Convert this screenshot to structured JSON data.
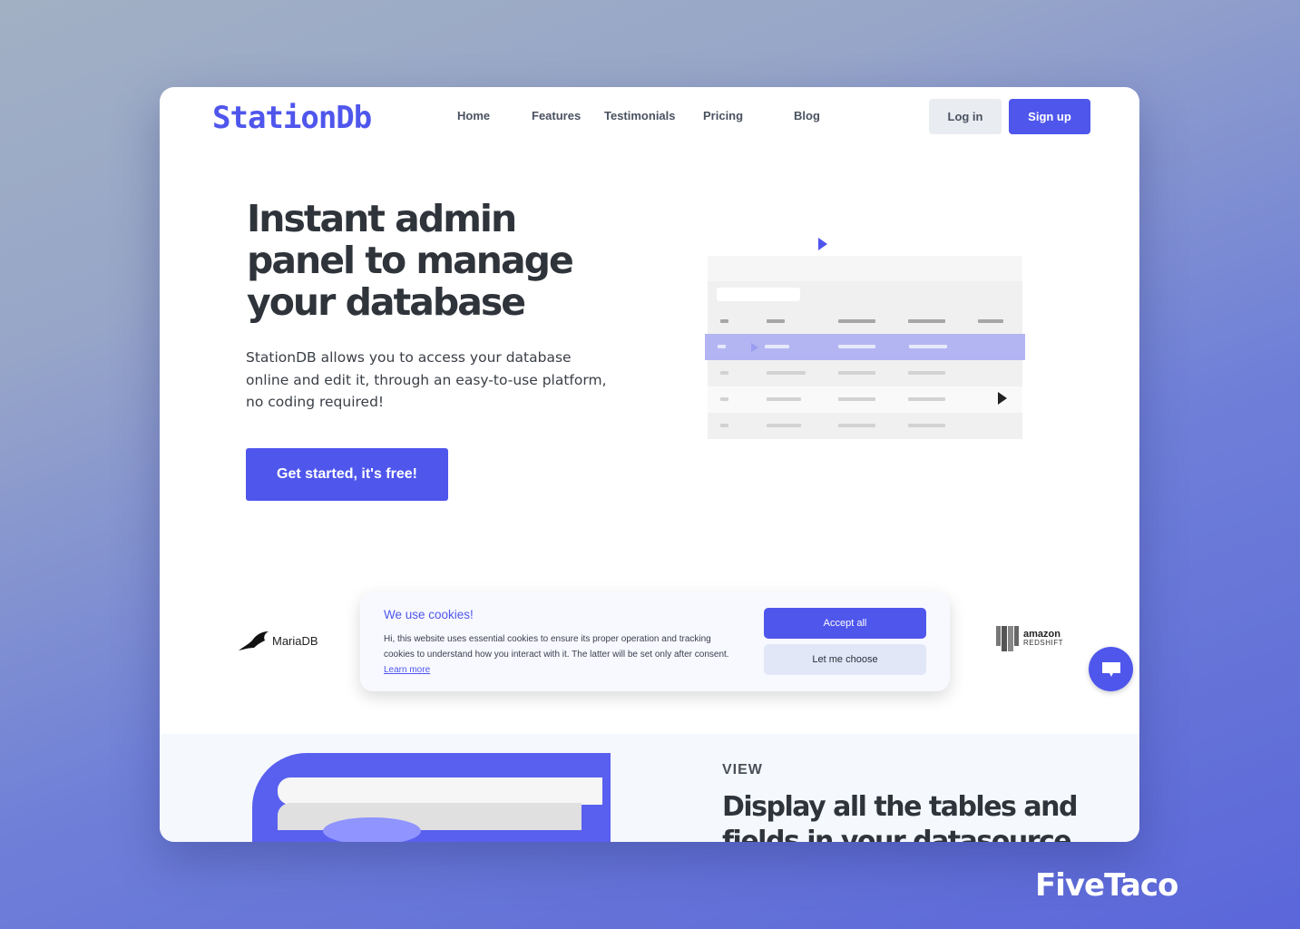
{
  "brand": {
    "logo": "StationDb",
    "accent": "#4f56ec",
    "watermark": "FiveTaco"
  },
  "nav": {
    "items": [
      "Home",
      "Features",
      "Testimonials",
      "Pricing",
      "Blog"
    ],
    "login": "Log in",
    "signup": "Sign up"
  },
  "hero": {
    "title": "Instant admin panel to manage your database",
    "description": "StationDB allows you to access your database online and edit it, through an easy-to-use platform, no coding required!",
    "cta": "Get started, it's free!"
  },
  "logos": {
    "left": "MariaDB",
    "right_top": "amazon",
    "right_bottom": "REDSHIFT"
  },
  "cookie": {
    "title": "We use cookies!",
    "text": "Hi, this website uses essential cookies to ensure its proper operation and tracking cookies to understand how you interact with it. The latter will be set only after consent.",
    "learn_more": "Learn more",
    "accept": "Accept all",
    "choose": "Let me choose"
  },
  "section": {
    "eyebrow": "VIEW",
    "title": "Display all the tables and fields in your datasource"
  },
  "chat": {
    "icon": "chat-bubble-icon"
  }
}
